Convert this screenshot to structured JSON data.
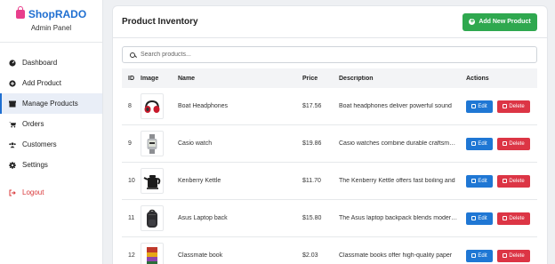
{
  "brand": {
    "name": "ShopRADO",
    "subtitle": "Admin Panel",
    "icon": "shopping-bag-icon",
    "color": "#1f6fd1"
  },
  "nav": [
    {
      "label": "Dashboard",
      "icon": "gauge-icon",
      "active": false
    },
    {
      "label": "Add Product",
      "icon": "plus-circle-icon",
      "active": false
    },
    {
      "label": "Manage Products",
      "icon": "box-icon",
      "active": true
    },
    {
      "label": "Orders",
      "icon": "cart-icon",
      "active": false
    },
    {
      "label": "Customers",
      "icon": "users-icon",
      "active": false
    },
    {
      "label": "Settings",
      "icon": "gear-icon",
      "active": false
    },
    {
      "label": "Logout",
      "icon": "logout-icon",
      "active": false
    }
  ],
  "main": {
    "title": "Product Inventory",
    "add_button": "Add New Product",
    "search_placeholder": "Search products...",
    "columns": [
      "ID",
      "Image",
      "Name",
      "Price",
      "Description",
      "Actions"
    ],
    "rows": [
      {
        "id": "8",
        "name": "Boat Headphones",
        "price": "$17.56",
        "description": "Boat headphones deliver powerful sound",
        "image": "headphones"
      },
      {
        "id": "9",
        "name": "Casio watch",
        "price": "$19.86",
        "description": "Casio watches combine durable craftsmanship",
        "image": "watch"
      },
      {
        "id": "10",
        "name": "Kenberry Kettle",
        "price": "$11.70",
        "description": "The Kenberry Kettle offers fast boiling and",
        "image": "kettle"
      },
      {
        "id": "11",
        "name": "Asus Laptop back",
        "price": "$15.80",
        "description": "The Asus laptop backpack blends modern design",
        "image": "backpack"
      },
      {
        "id": "12",
        "name": "Classmate book",
        "price": "$2.03",
        "description": "Classmate books offer high-quality paper",
        "image": "book"
      }
    ],
    "edit_label": "Edit",
    "delete_label": "Delete"
  },
  "colors": {
    "accent": "#1f6fd1",
    "add": "#2fa84f",
    "edit": "#1f77d4",
    "delete": "#dc3545",
    "logout": "#d9383a"
  }
}
